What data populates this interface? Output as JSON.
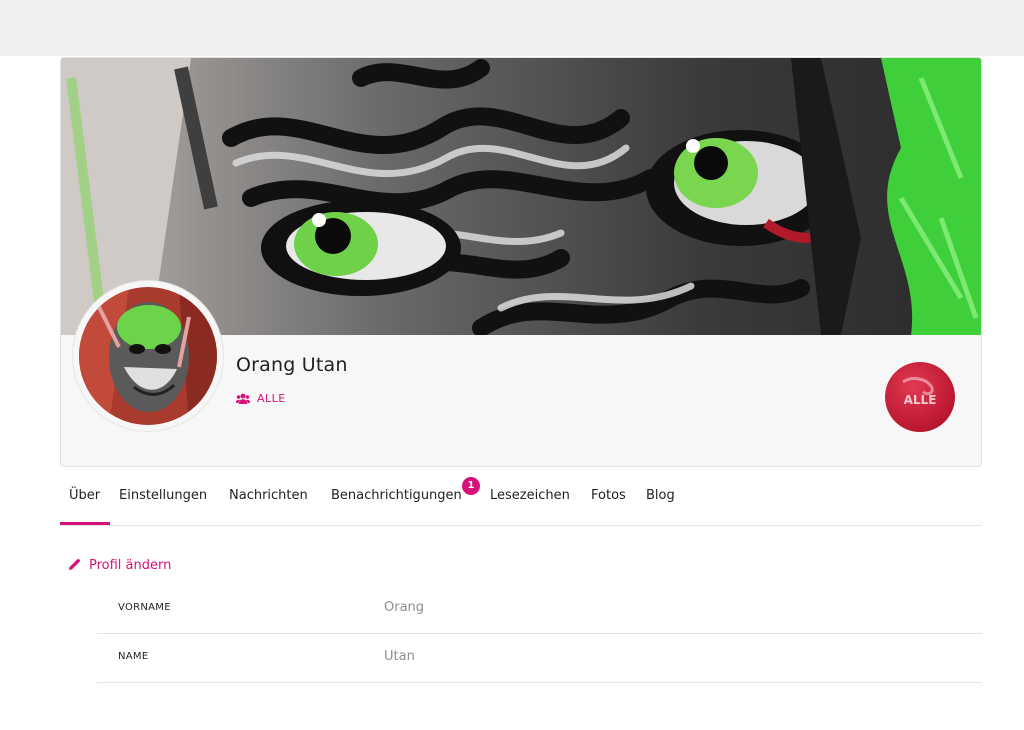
{
  "profile": {
    "name": "Orang Utan",
    "group_label": "ALLE"
  },
  "tabs": [
    {
      "label": "Über",
      "active": true
    },
    {
      "label": "Einstellungen"
    },
    {
      "label": "Nachrichten"
    },
    {
      "label": "Benachrichtigungen",
      "badge": "1"
    },
    {
      "label": "Lesezeichen"
    },
    {
      "label": "Fotos"
    },
    {
      "label": "Blog"
    }
  ],
  "actions": {
    "edit_profile": "Profil ändern"
  },
  "fields": [
    {
      "label": "VORNAME",
      "value": "Orang"
    },
    {
      "label": "NAME",
      "value": "Utan"
    }
  ],
  "badge_text": "ALLE",
  "colors": {
    "accent": "#d6127a",
    "topbar": "#efefef",
    "muted_text": "#8f8f8f"
  },
  "icons": {
    "group": "users-icon",
    "edit": "pencil-icon"
  }
}
